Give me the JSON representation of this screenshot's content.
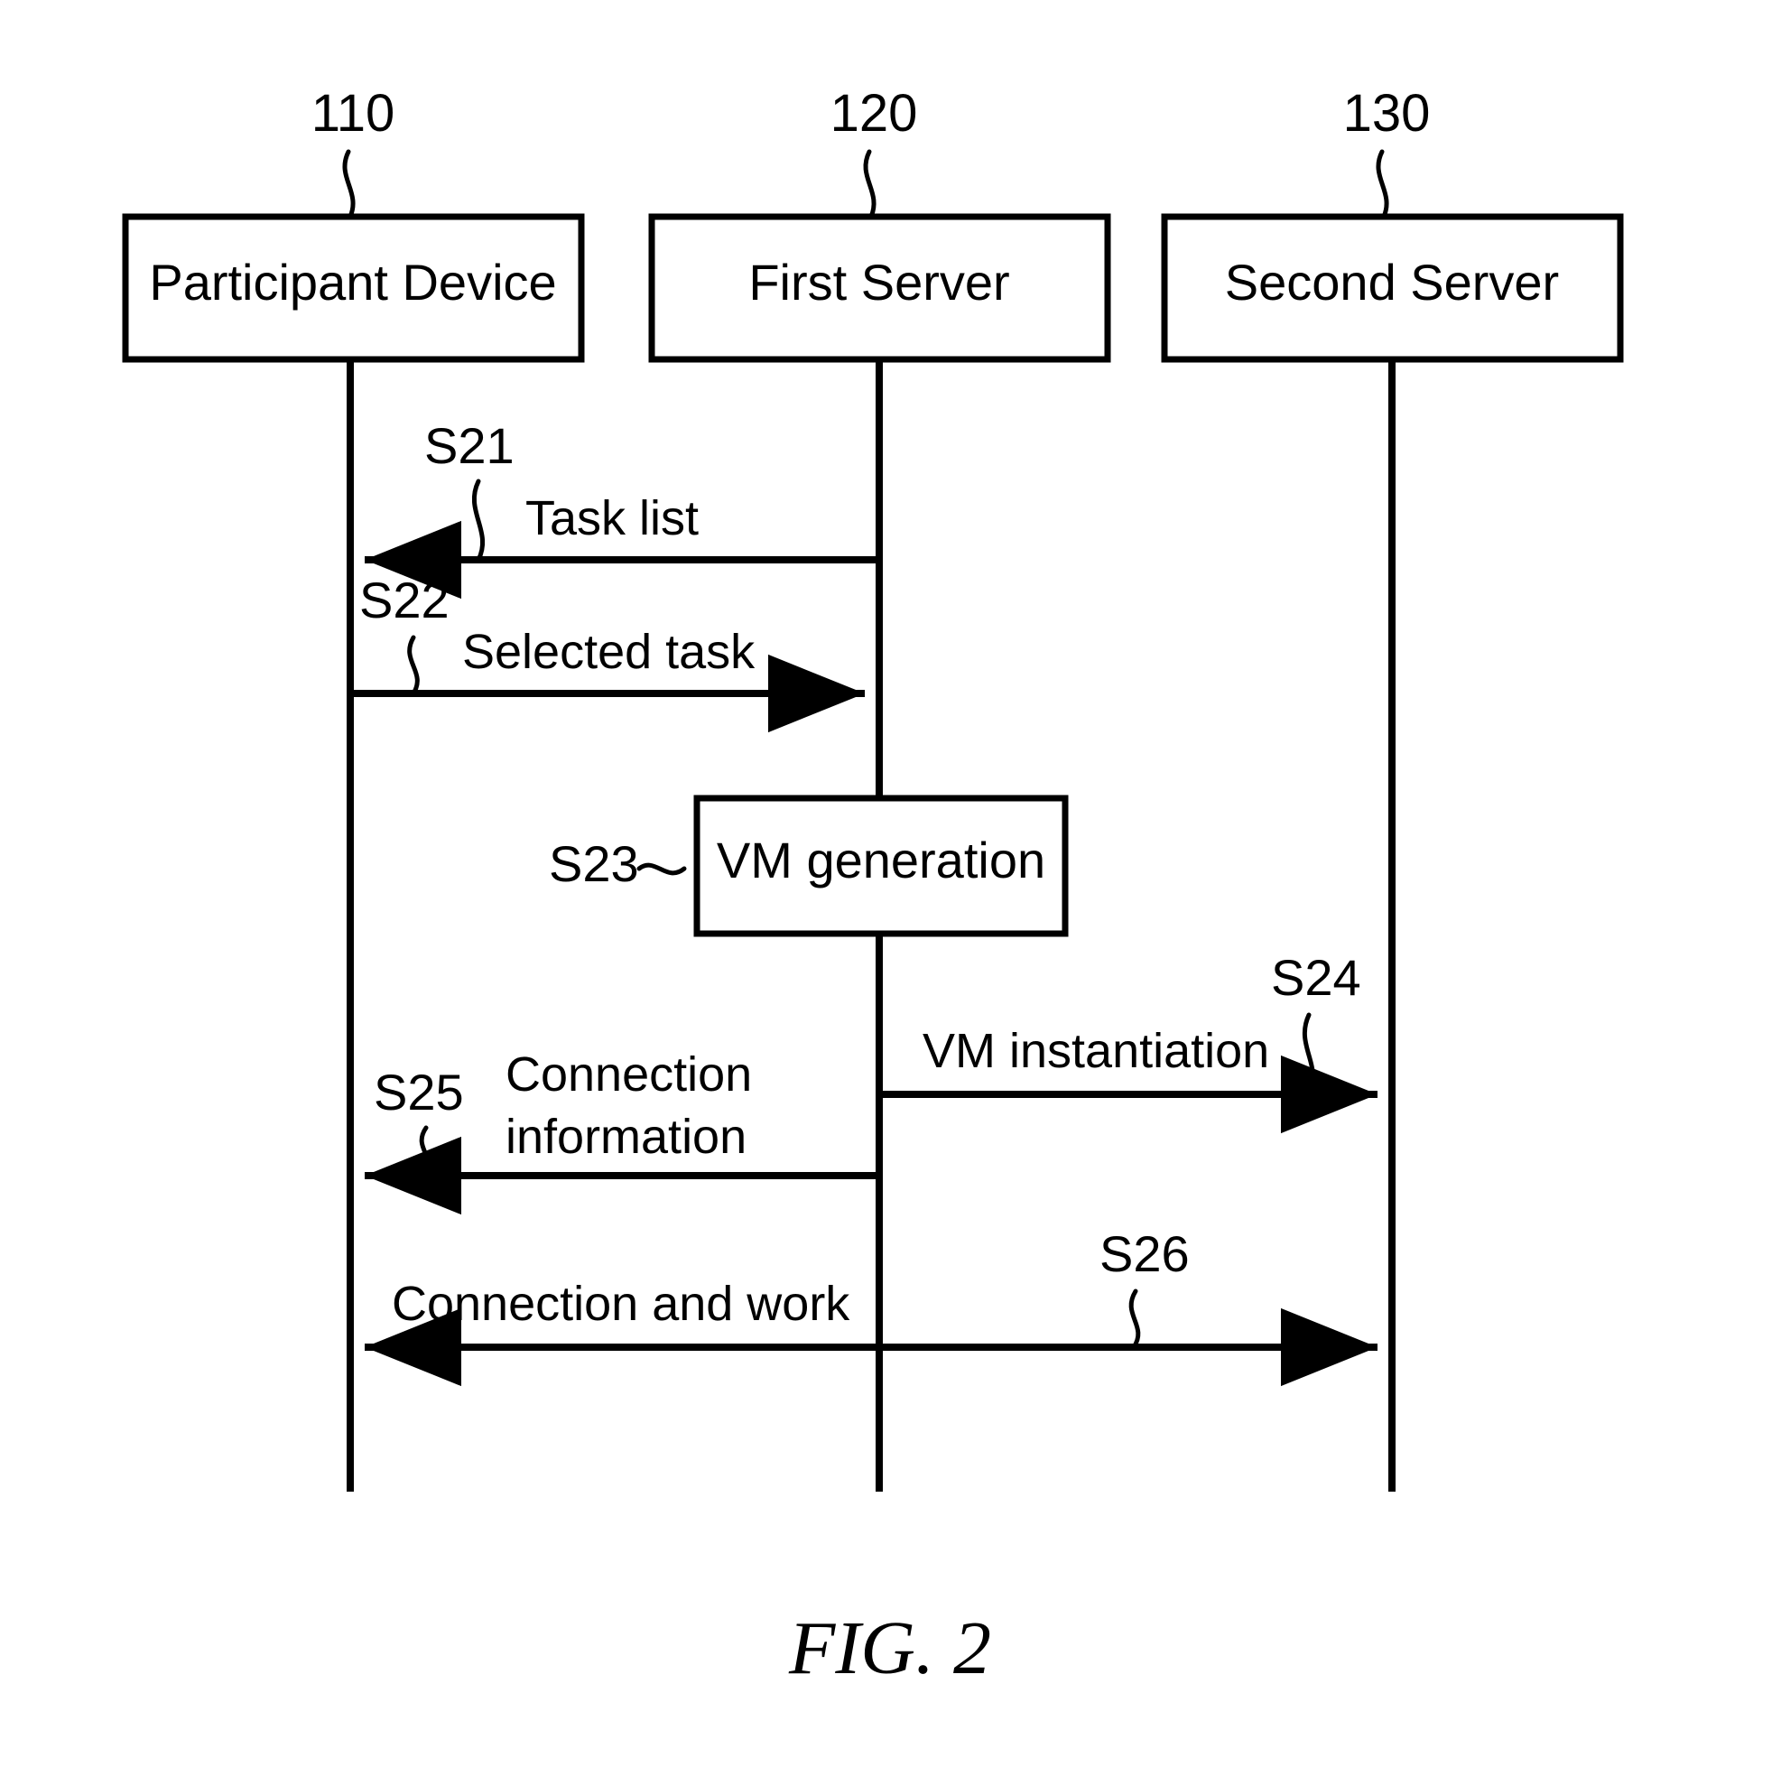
{
  "figure": {
    "caption": "FIG. 2",
    "type": "sequence-diagram"
  },
  "lifelines": [
    {
      "ref": "110",
      "title": "Participant Device"
    },
    {
      "ref": "120",
      "title": "First Server"
    },
    {
      "ref": "130",
      "title": "Second Server"
    }
  ],
  "steps": [
    {
      "id": "S21",
      "label": "Task list",
      "from": "120",
      "to": "110",
      "direction": "left"
    },
    {
      "id": "S22",
      "label": "Selected task",
      "from": "110",
      "to": "120",
      "direction": "right"
    },
    {
      "id": "S23",
      "label": "VM generation",
      "on": "120",
      "kind": "activity-box"
    },
    {
      "id": "S24",
      "label": "VM instantiation",
      "from": "120",
      "to": "130",
      "direction": "right"
    },
    {
      "id": "S25",
      "label_line1": "Connection",
      "label_line2": "information",
      "from": "120",
      "to": "110",
      "direction": "left"
    },
    {
      "id": "S26",
      "label": "Connection and work",
      "from": "110",
      "to": "130",
      "direction": "both"
    }
  ],
  "colors": {
    "ink": "#000000",
    "paper": "#ffffff"
  }
}
